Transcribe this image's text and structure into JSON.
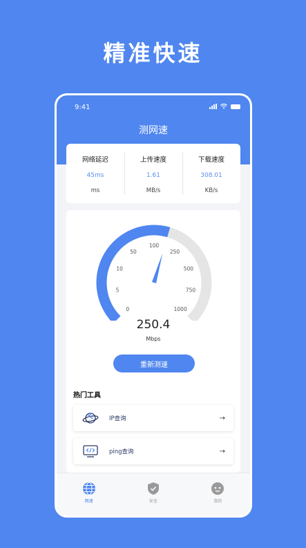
{
  "hero": {
    "title": "精准快速"
  },
  "status_bar": {
    "time": "9:41"
  },
  "nav": {
    "title": "测网速"
  },
  "stats": [
    {
      "label": "网络延迟",
      "value": "45ms",
      "unit": "ms"
    },
    {
      "label": "上传速度",
      "value": "1.61",
      "unit": "MB/s"
    },
    {
      "label": "下载速度",
      "value": "308.01",
      "unit": "KB/s"
    }
  ],
  "gauge": {
    "ticks": [
      "0",
      "5",
      "10",
      "50",
      "100",
      "250",
      "500",
      "750",
      "1000"
    ],
    "value_fraction": 0.56,
    "accent_color": "#4f86ef",
    "track_color": "#e5e5e5"
  },
  "speed": {
    "value": "250.4",
    "unit": "Mbps"
  },
  "actions": {
    "retest_label": "重新测速"
  },
  "tools": {
    "title": "热门工具",
    "items": [
      {
        "label": "IP查询",
        "icon": "ip-globe-icon",
        "arrow": "→"
      },
      {
        "label": "ping查询",
        "icon": "code-monitor-icon",
        "arrow": "→"
      }
    ]
  },
  "tabbar": {
    "items": [
      {
        "label": "网速",
        "icon": "globe-icon",
        "active": true
      },
      {
        "label": "安全",
        "icon": "shield-icon",
        "active": false
      },
      {
        "label": "我的",
        "icon": "profile-icon",
        "active": false
      }
    ]
  }
}
